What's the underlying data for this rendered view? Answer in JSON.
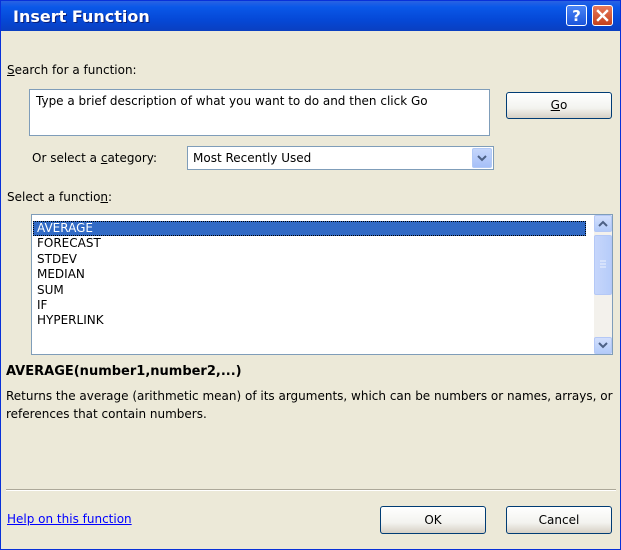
{
  "window": {
    "title": "Insert Function"
  },
  "search": {
    "label_prefix": "",
    "label_hotkey": "S",
    "label_rest": "earch for a function:",
    "value": "Type a brief description of what you want to do and then click Go",
    "go_hotkey": "G",
    "go_rest": "o"
  },
  "category": {
    "label_prefix": "Or select a ",
    "label_hotkey": "c",
    "label_rest": "ategory:",
    "selected": "Most Recently Used"
  },
  "functions": {
    "label_prefix": "Select a functio",
    "label_hotkey": "n",
    "label_rest": ":",
    "items": [
      "AVERAGE",
      "FORECAST",
      "STDEV",
      "MEDIAN",
      "SUM",
      "IF",
      "HYPERLINK"
    ],
    "selected_index": 0
  },
  "details": {
    "signature": "AVERAGE(number1,number2,...)",
    "description": "Returns the average (arithmetic mean) of its arguments, which can be numbers or names, arrays, or references that contain numbers."
  },
  "footer": {
    "help_link": "Help on this function",
    "ok_label": "OK",
    "cancel_label": "Cancel"
  },
  "icons": {
    "help": "help-icon",
    "close": "close-icon",
    "dropdown": "chevron-down-icon",
    "scroll_up": "arrow-up-icon",
    "scroll_down": "arrow-down-icon"
  }
}
